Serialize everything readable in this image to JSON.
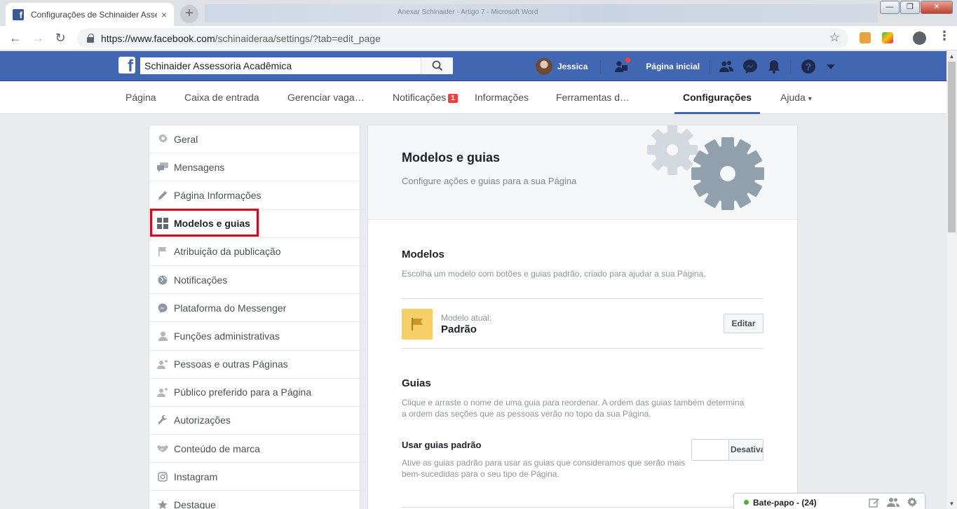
{
  "browser": {
    "tab_title": "Configurações de Schinaider Assessoria Acadêmica",
    "tab_close": "×",
    "new_tab": "+",
    "background_window_text": "Anexar Schinaider - Artigo 7 - Microsoft Word",
    "window_minimize": "—",
    "window_maximize": "❐",
    "window_close": "✕",
    "back": "←",
    "forward": "→",
    "reload": "↻",
    "url_host": "https://www.facebook.com",
    "url_path": "/schinaideraa/settings/?tab=edit_page",
    "bookmark_star": "☆",
    "menu_dots": "⋮"
  },
  "fb_header": {
    "search_value": "Schinaider Assessoria Acadêmica",
    "user_name": "Jessica",
    "home_label": "Página inicial"
  },
  "page_nav": {
    "items": [
      "Página",
      "Caixa de entrada",
      "Gerenciar vaga…",
      "Notificações",
      "Informações",
      "Ferramentas d…",
      "Configurações",
      "Ajuda"
    ],
    "notifications_badge": "1",
    "help_caret": "▾"
  },
  "sidebar": {
    "items": [
      {
        "label": "Geral",
        "icon": "gear-icon"
      },
      {
        "label": "Mensagens",
        "icon": "messages-icon"
      },
      {
        "label": "Página Informações",
        "icon": "pencil-icon"
      },
      {
        "label": "Modelos e guias",
        "icon": "grid-icon"
      },
      {
        "label": "Atribuição da publicação",
        "icon": "flag-icon"
      },
      {
        "label": "Notificações",
        "icon": "globe-icon"
      },
      {
        "label": "Plataforma do Messenger",
        "icon": "messenger-icon"
      },
      {
        "label": "Funções administrativas",
        "icon": "person-icon"
      },
      {
        "label": "Pessoas e outras Páginas",
        "icon": "person-add-icon"
      },
      {
        "label": "Público preferido para a Página",
        "icon": "person-add-icon"
      },
      {
        "label": "Autorizações",
        "icon": "wrench-icon"
      },
      {
        "label": "Conteúdo de marca",
        "icon": "handshake-icon"
      },
      {
        "label": "Instagram",
        "icon": "instagram-icon"
      },
      {
        "label": "Destaque",
        "icon": "star-icon"
      }
    ],
    "active_index": 3
  },
  "main": {
    "title": "Modelos e guias",
    "subtitle": "Configure ações e guias para a sua Página",
    "templates": {
      "heading": "Modelos",
      "description": "Escolha um modelo com botões e guias padrão, criado para ajudar a sua Página.",
      "current_label": "Modelo atual:",
      "current_value": "Padrão",
      "edit_button": "Editar"
    },
    "tabs": {
      "heading": "Guias",
      "description": "Clique e arraste o nome de uma guia para reordenar. A ordem das guias também determina a ordem das seções que as pessoas verão no topo da sua Página.",
      "default_heading": "Usar guias padrão",
      "default_description": "Ative as guias padrão para usar as guias que consideramos que serão mais bem-sucedidas para o seu tipo de Página.",
      "toggle_label": "Desativado"
    }
  },
  "chat": {
    "label": "Bate-papo - (24)",
    "status_color": "#42b72a"
  },
  "colors": {
    "facebook_blue": "#4267b2",
    "highlight_red": "#e0001a",
    "template_yellow": "#f7cf67"
  }
}
